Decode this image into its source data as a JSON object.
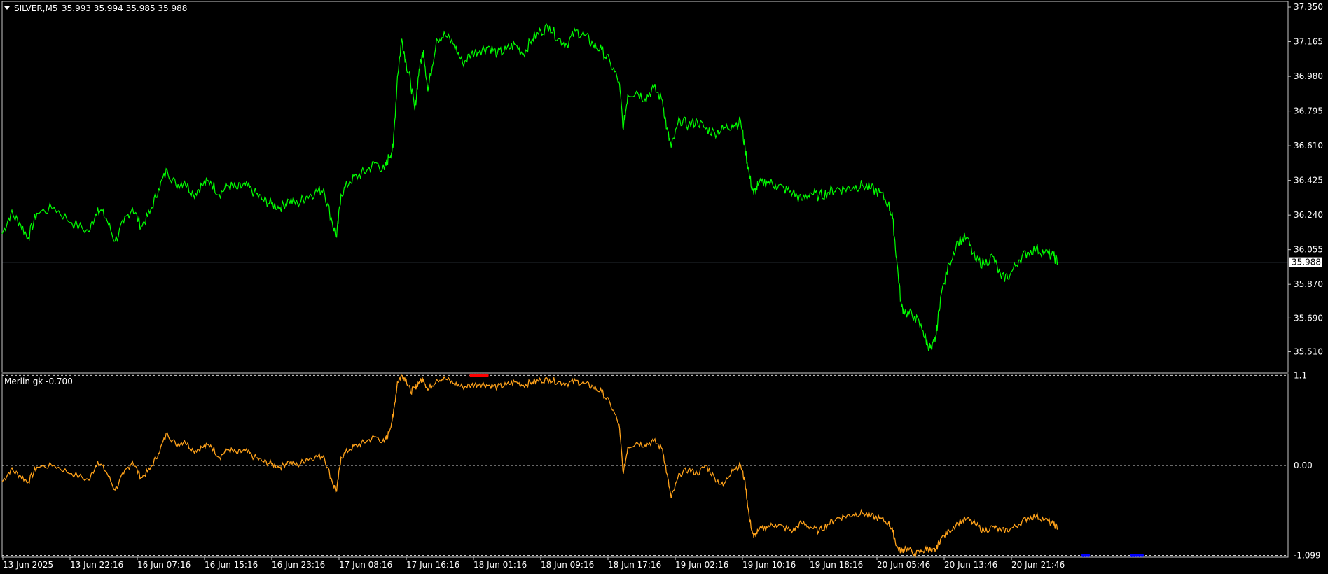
{
  "header": {
    "symbol": "SILVER,M5",
    "ohlc": "35.993 35.994 35.985 35.988"
  },
  "colors": {
    "background": "#000000",
    "frame": "#c8c8c8",
    "price_line": "#00ff00",
    "indicator_line": "#ffa21a",
    "current_price_line": "#8fa8c0",
    "level_line": "#d0d0d0",
    "overbought_marker": "#ff0000",
    "oversold_marker": "#0000ff"
  },
  "chart_data": [
    {
      "type": "line",
      "name": "SILVER,M5",
      "ylim": [
        35.4,
        37.38
      ],
      "yticks": [
        "37.350",
        "37.165",
        "36.980",
        "36.795",
        "36.610",
        "36.425",
        "36.240",
        "36.055",
        "35.870",
        "35.690",
        "35.510"
      ],
      "current_price": "35.988",
      "x": [
        0,
        10,
        20,
        30,
        40,
        60,
        80,
        100,
        110,
        120,
        130,
        140,
        150,
        160,
        170,
        180,
        190,
        200,
        210,
        220,
        230,
        240,
        250,
        260,
        270,
        280,
        290,
        300,
        310,
        320,
        330,
        340,
        350,
        360,
        370,
        380,
        385,
        390,
        400,
        410,
        420,
        430,
        440,
        445,
        450,
        455,
        460,
        465,
        470,
        475,
        480,
        485,
        490,
        500,
        510,
        520,
        530,
        540,
        550,
        560,
        570,
        580,
        590,
        600,
        610,
        620,
        630,
        640,
        650,
        660,
        670,
        680,
        690,
        700,
        710,
        715,
        720,
        730,
        740,
        750,
        760,
        765,
        770,
        780,
        790,
        800,
        810,
        820,
        830,
        840,
        850,
        855,
        860,
        865,
        870,
        880,
        890,
        900,
        910,
        920,
        930,
        940,
        950,
        960,
        970,
        980,
        990,
        1000,
        1010,
        1020,
        1025,
        1030,
        1035,
        1040,
        1050,
        1060,
        1065,
        1070,
        1075,
        1080,
        1090,
        1100,
        1110,
        1120,
        1130,
        1140,
        1150,
        1160,
        1170,
        1180,
        1190,
        1200,
        1210,
        1215
      ],
      "values": [
        36.14,
        36.25,
        36.2,
        36.12,
        36.25,
        36.28,
        36.2,
        36.15,
        36.28,
        36.22,
        36.1,
        36.2,
        36.28,
        36.18,
        36.25,
        36.38,
        36.48,
        36.4,
        36.42,
        36.35,
        36.4,
        36.42,
        36.35,
        36.4,
        36.38,
        36.4,
        36.36,
        36.32,
        36.3,
        36.28,
        36.32,
        36.3,
        36.34,
        36.36,
        36.38,
        36.2,
        36.12,
        36.35,
        36.42,
        36.45,
        36.48,
        36.52,
        36.48,
        36.55,
        36.6,
        36.98,
        37.18,
        37.05,
        36.95,
        36.8,
        37.02,
        37.12,
        36.9,
        37.18,
        37.2,
        37.15,
        37.05,
        37.1,
        37.12,
        37.14,
        37.1,
        37.12,
        37.15,
        37.1,
        37.18,
        37.22,
        37.25,
        37.18,
        37.15,
        37.22,
        37.2,
        37.15,
        37.12,
        37.05,
        36.95,
        36.7,
        36.88,
        36.9,
        36.86,
        36.92,
        36.85,
        36.7,
        36.6,
        36.75,
        36.72,
        36.74,
        36.7,
        36.68,
        36.7,
        36.72,
        36.74,
        36.6,
        36.45,
        36.35,
        36.4,
        36.42,
        36.4,
        36.38,
        36.36,
        36.32,
        36.36,
        36.34,
        36.36,
        36.38,
        36.38,
        36.39,
        36.4,
        36.38,
        36.36,
        36.3,
        36.22,
        35.98,
        35.75,
        35.72,
        35.7,
        35.62,
        35.55,
        35.52,
        35.6,
        35.8,
        35.98,
        36.1,
        36.12,
        36.0,
        35.98,
        36.02,
        35.9,
        35.92,
        36.0,
        36.04,
        36.06,
        36.04,
        36.02,
        35.99
      ]
    },
    {
      "type": "line",
      "name": "Merlin gk -0.700",
      "ylim": [
        -1.12,
        1.12
      ],
      "yticks": [
        "1.1",
        "0.00",
        "-1.099"
      ],
      "levels": [
        1.1,
        0.0,
        -1.099
      ],
      "overbought_x_range": [
        540,
        558
      ],
      "oversold_x_ranges": [
        [
          1244,
          1250
        ],
        [
          1300,
          1312
        ]
      ],
      "x": [
        0,
        10,
        20,
        30,
        40,
        60,
        80,
        100,
        110,
        120,
        130,
        140,
        150,
        160,
        170,
        180,
        190,
        200,
        210,
        220,
        230,
        240,
        250,
        260,
        270,
        280,
        290,
        300,
        310,
        320,
        330,
        340,
        350,
        360,
        370,
        380,
        385,
        390,
        400,
        410,
        420,
        430,
        440,
        445,
        450,
        455,
        460,
        465,
        470,
        475,
        480,
        485,
        490,
        500,
        510,
        520,
        530,
        540,
        550,
        560,
        570,
        580,
        590,
        600,
        610,
        620,
        630,
        640,
        650,
        660,
        670,
        680,
        690,
        700,
        710,
        715,
        720,
        730,
        740,
        750,
        760,
        765,
        770,
        780,
        790,
        800,
        810,
        820,
        830,
        840,
        850,
        855,
        860,
        865,
        870,
        880,
        890,
        900,
        910,
        920,
        930,
        940,
        950,
        960,
        970,
        980,
        990,
        1000,
        1010,
        1020,
        1025,
        1030,
        1035,
        1040,
        1050,
        1060,
        1065,
        1070,
        1075,
        1080,
        1090,
        1100,
        1110,
        1120,
        1130,
        1140,
        1150,
        1160,
        1170,
        1180,
        1190,
        1200,
        1210,
        1215
      ],
      "values": [
        -0.2,
        -0.05,
        -0.12,
        -0.2,
        -0.02,
        0.0,
        -0.1,
        -0.18,
        0.05,
        -0.08,
        -0.3,
        -0.1,
        0.05,
        -0.15,
        -0.05,
        0.15,
        0.4,
        0.25,
        0.3,
        0.18,
        0.22,
        0.25,
        0.1,
        0.2,
        0.15,
        0.18,
        0.1,
        0.05,
        0.02,
        -0.02,
        0.05,
        0.0,
        0.08,
        0.1,
        0.12,
        -0.2,
        -0.32,
        0.1,
        0.2,
        0.25,
        0.3,
        0.35,
        0.28,
        0.4,
        0.6,
        1.02,
        1.1,
        1.05,
        0.9,
        0.95,
        1.02,
        1.06,
        0.92,
        1.05,
        1.06,
        1.0,
        0.96,
        0.98,
        1.0,
        0.98,
        0.96,
        0.98,
        1.02,
        0.98,
        1.02,
        1.04,
        1.05,
        1.02,
        1.0,
        1.03,
        1.0,
        0.96,
        0.9,
        0.75,
        0.5,
        -0.1,
        0.22,
        0.28,
        0.25,
        0.3,
        0.2,
        -0.1,
        -0.4,
        -0.1,
        -0.05,
        -0.1,
        0.0,
        -0.15,
        -0.25,
        -0.05,
        0.0,
        -0.2,
        -0.65,
        -0.88,
        -0.8,
        -0.75,
        -0.72,
        -0.76,
        -0.8,
        -0.7,
        -0.75,
        -0.8,
        -0.72,
        -0.65,
        -0.62,
        -0.6,
        -0.58,
        -0.62,
        -0.65,
        -0.7,
        -0.8,
        -1.0,
        -1.05,
        -1.0,
        -1.08,
        -1.05,
        -1.0,
        -1.06,
        -1.02,
        -0.9,
        -0.8,
        -0.7,
        -0.65,
        -0.72,
        -0.8,
        -0.75,
        -0.8,
        -0.78,
        -0.72,
        -0.64,
        -0.62,
        -0.66,
        -0.72,
        -0.76
      ]
    }
  ],
  "x_axis": {
    "labels": [
      "13 Jun 2025",
      "13 Jun 22:16",
      "16 Jun 07:16",
      "16 Jun 15:16",
      "16 Jun 23:16",
      "17 Jun 08:16",
      "17 Jun 16:16",
      "18 Jun 01:16",
      "18 Jun 09:16",
      "18 Jun 17:16",
      "19 Jun 02:16",
      "19 Jun 10:16",
      "19 Jun 18:16",
      "20 Jun 05:46",
      "20 Jun 13:46",
      "20 Jun 21:46"
    ]
  }
}
